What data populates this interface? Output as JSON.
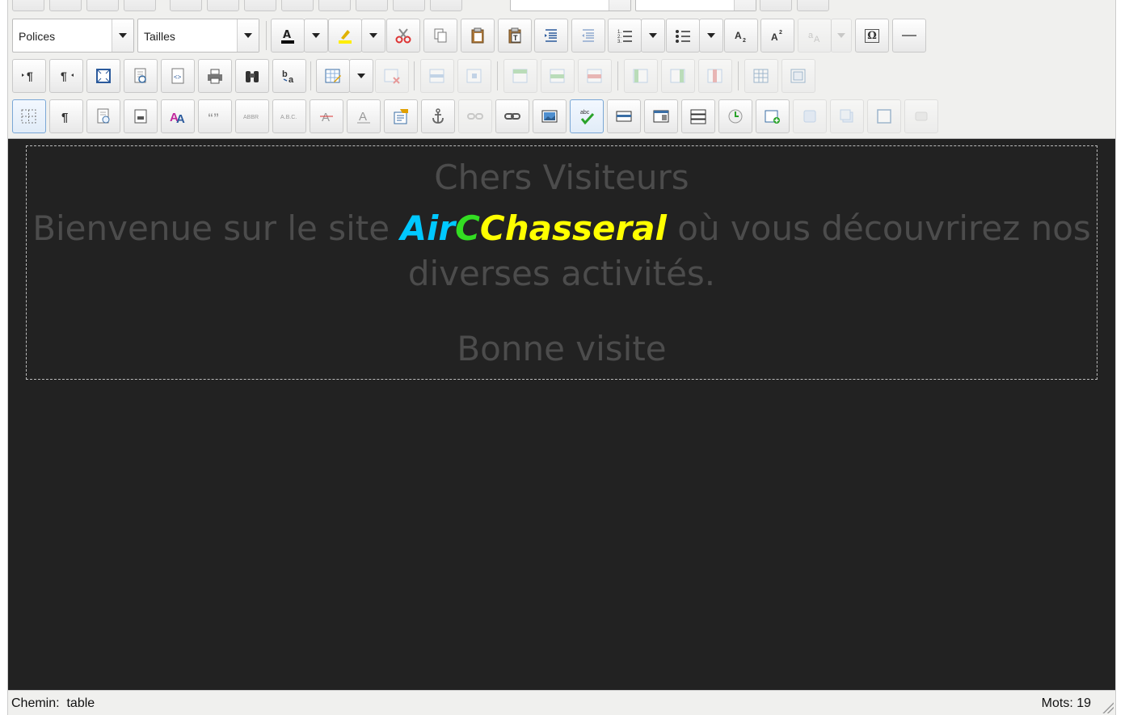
{
  "toolbar": {
    "font_select": "Polices",
    "size_select": "Tailles",
    "row4_glyphs": {
      "special_char": "Ω"
    }
  },
  "content": {
    "line1": "Chers Visiteurs",
    "line2_before": "Bienvenue sur le site ",
    "brand_part1": "Air",
    "brand_part2": "C",
    "brand_part3": "Chasseral",
    "line2_after": " où vous découvrirez nos diverses activités.",
    "line3": "Bonne visite",
    "colors": {
      "part1": "#00c8ff",
      "part2": "#33dd22",
      "part3": "#ffff00"
    }
  },
  "status": {
    "path_label": "Chemin:",
    "path_value": "table",
    "words": "Mots: 19"
  }
}
